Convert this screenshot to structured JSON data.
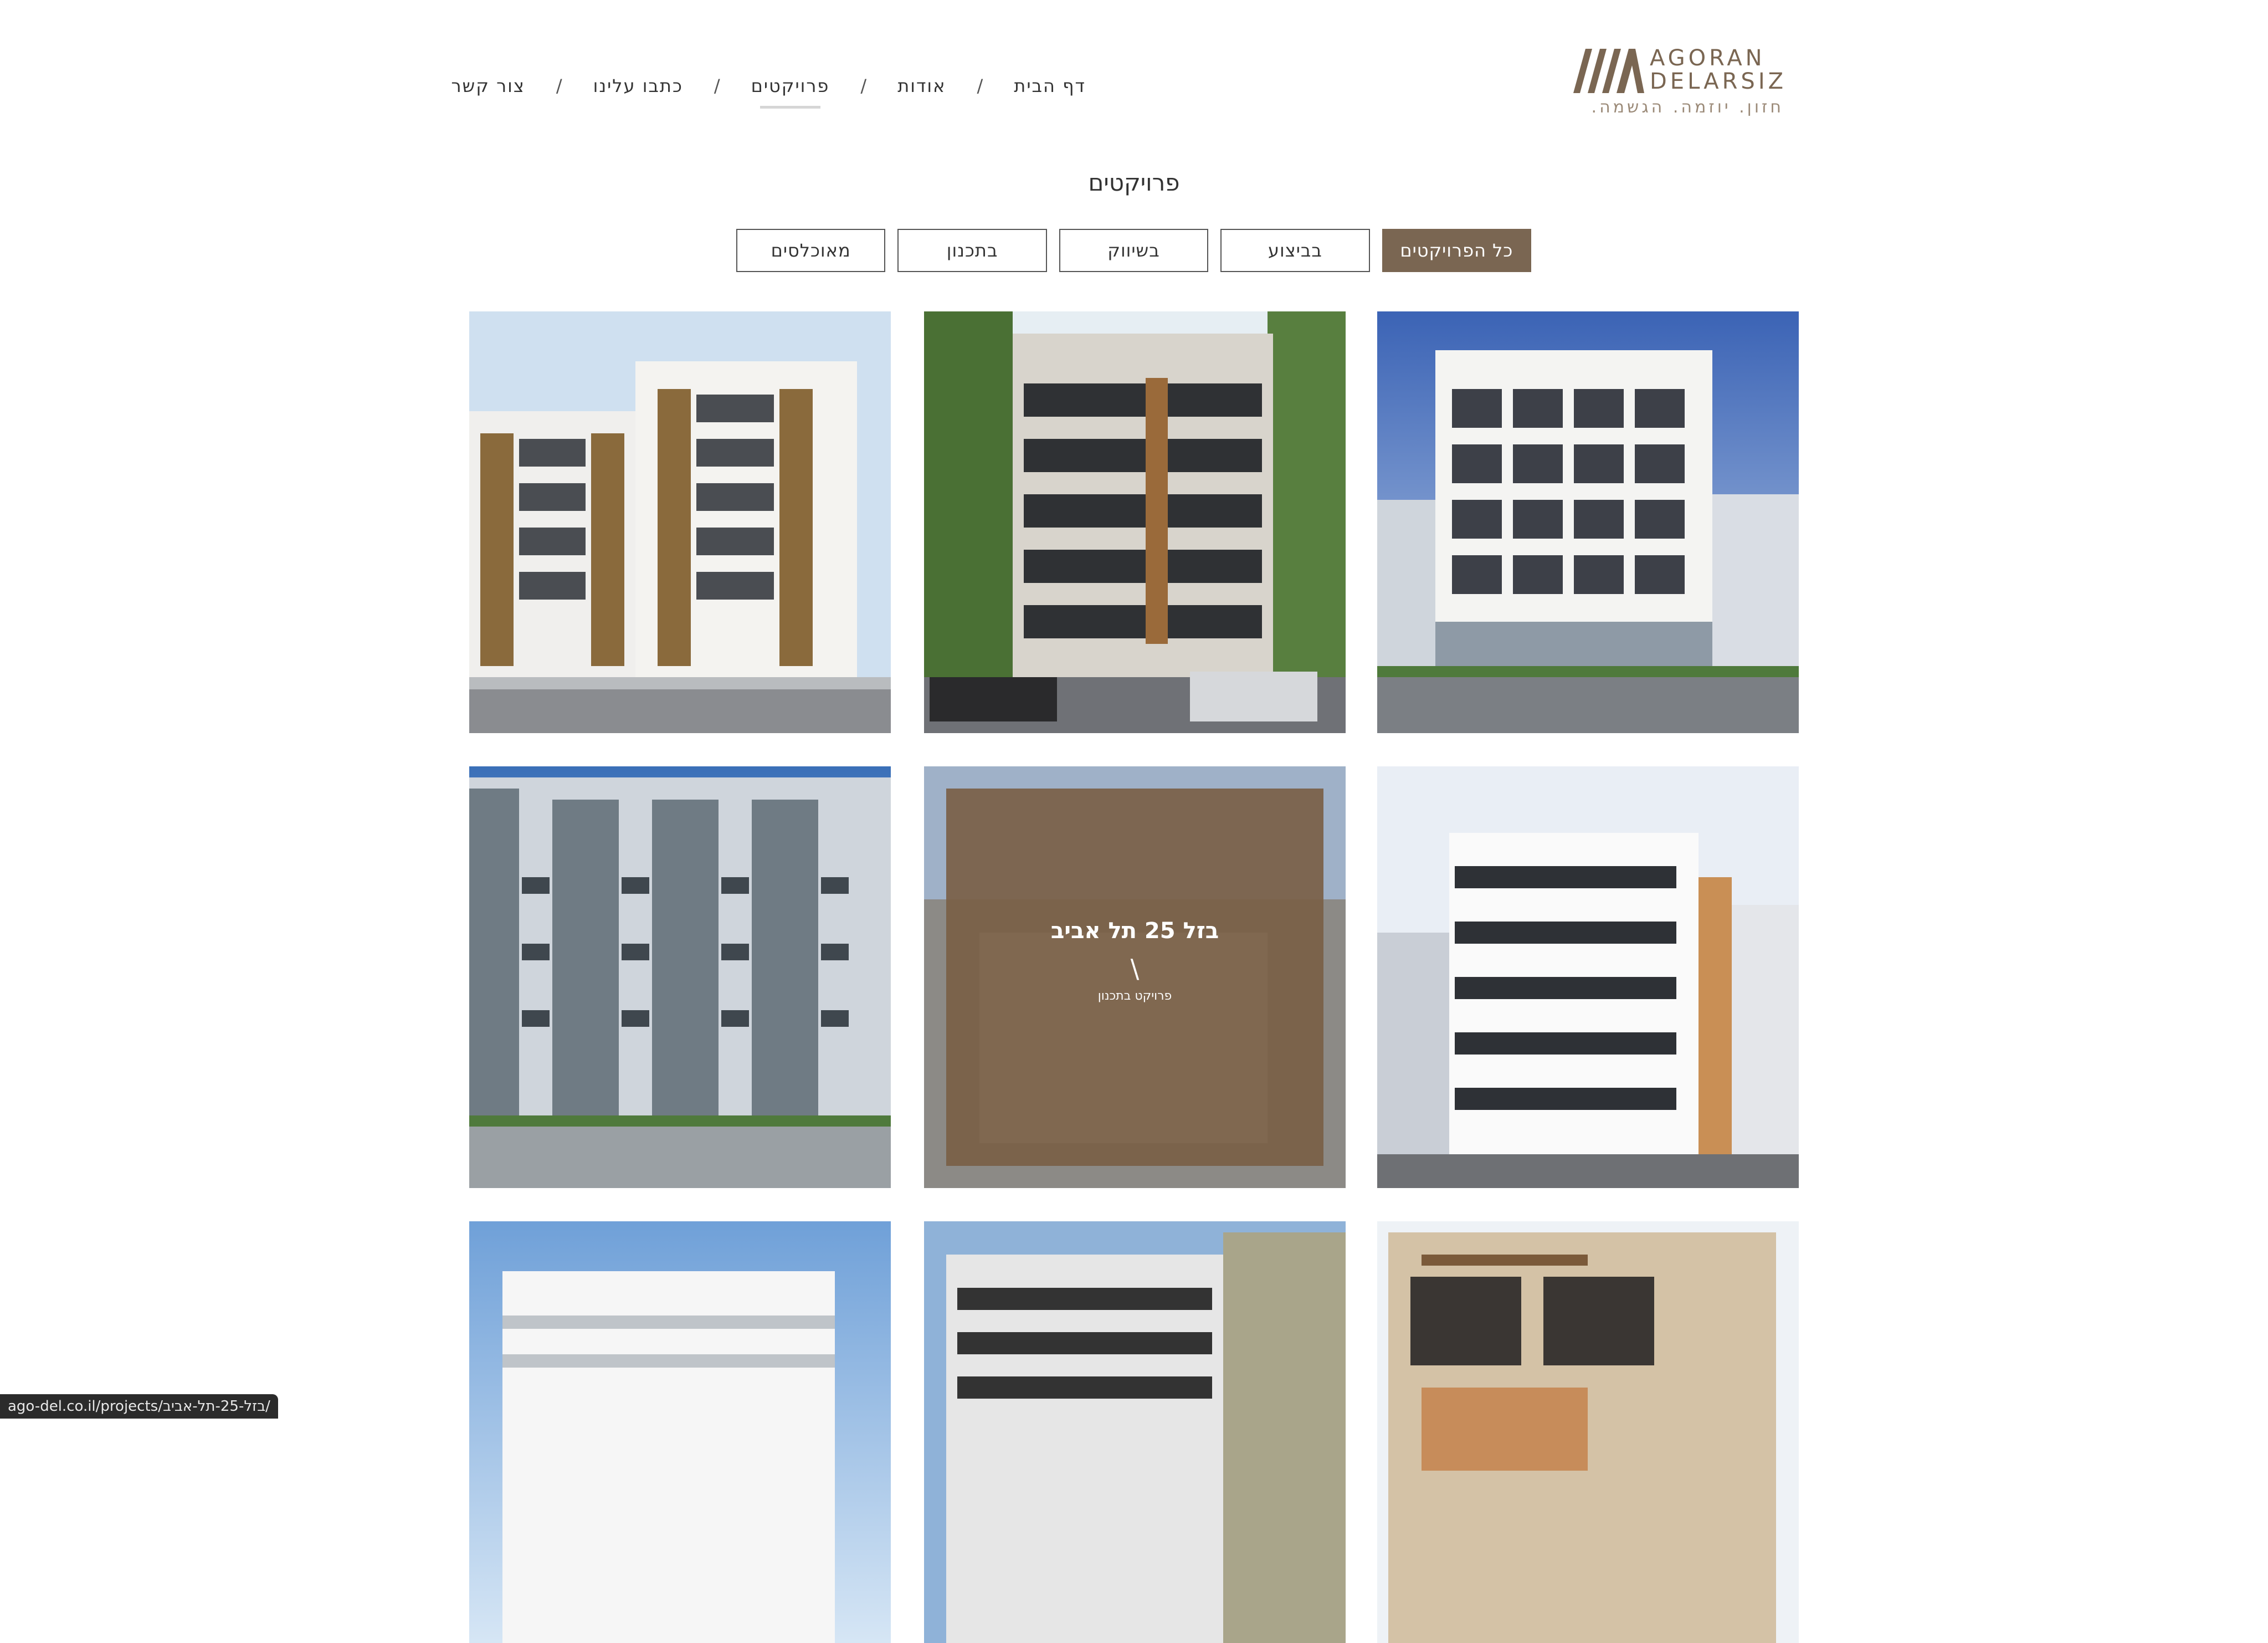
{
  "brand": {
    "line1": "AGORAN",
    "line2": "DELARSIZ",
    "tagline": "חזון. יוזמה. הגשמה.",
    "color": "#7a6652"
  },
  "nav": {
    "items": [
      {
        "label": "דף הבית",
        "active": false
      },
      {
        "label": "אודות",
        "active": false
      },
      {
        "label": "פרויקטים",
        "active": true
      },
      {
        "label": "כתבו עלינו",
        "active": false
      },
      {
        "label": "צור קשר",
        "active": false
      }
    ],
    "separator": "/"
  },
  "page": {
    "title": "פרויקטים"
  },
  "filters": [
    {
      "label": "כל הפרויקטים",
      "active": true
    },
    {
      "label": "בביצוע",
      "active": false
    },
    {
      "label": "בשיווק",
      "active": false
    },
    {
      "label": "בתכנון",
      "active": false
    },
    {
      "label": "מאוכלסים",
      "active": false
    }
  ],
  "projects": {
    "hover_card": {
      "title": "בזל 25 תל אביב",
      "divider": "\\",
      "status": "פרויקט בתכנון"
    }
  },
  "statusbar": {
    "url": "ago-del.co.il/projects/בזל-25-תל-אביב/"
  },
  "colors": {
    "accent": "#7a6652",
    "overlay": "#7a6046"
  }
}
